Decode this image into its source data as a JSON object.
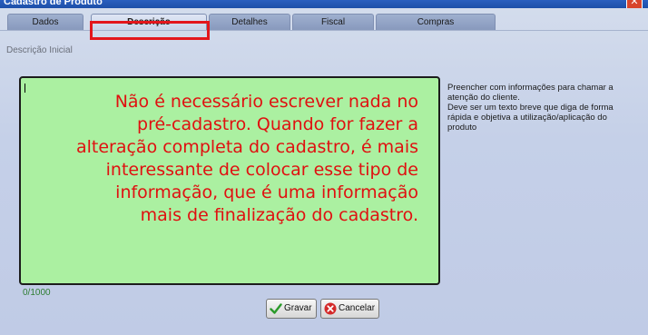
{
  "window": {
    "title": "Cadastro de Produto",
    "close_glyph": "✕"
  },
  "tabs": [
    {
      "label": "Dados"
    },
    {
      "label": "Descrição"
    },
    {
      "label": "Detalhes"
    },
    {
      "label": "Fiscal"
    },
    {
      "label": "Compras"
    }
  ],
  "active_tab": "Descrição",
  "section": {
    "label": "Descrição Inicial"
  },
  "editor": {
    "value": "",
    "annotation": "Não é necessário escrever nada no pré-cadastro. Quando for fazer a alteração completa do cadastro, é mais interessante de colocar esse tipo de informação, que é uma informação mais de finalização do cadastro.",
    "counter": "0/1000",
    "background_color": "#abf0a1",
    "annotation_color": "#e01010"
  },
  "help": {
    "line1": "Preencher com informações para chamar a atenção do cliente.",
    "line2": "Deve ser um texto breve que diga de forma rápida e objetiva a utilização/aplicação do produto"
  },
  "buttons": {
    "save_label": "Gravar",
    "save_icon": "check-icon",
    "cancel_label": "Cancelar",
    "cancel_icon": "cancel-icon"
  },
  "colors": {
    "titlebar": "#1d4fa8",
    "highlight": "#e3161c",
    "counter": "#2e7d32"
  }
}
